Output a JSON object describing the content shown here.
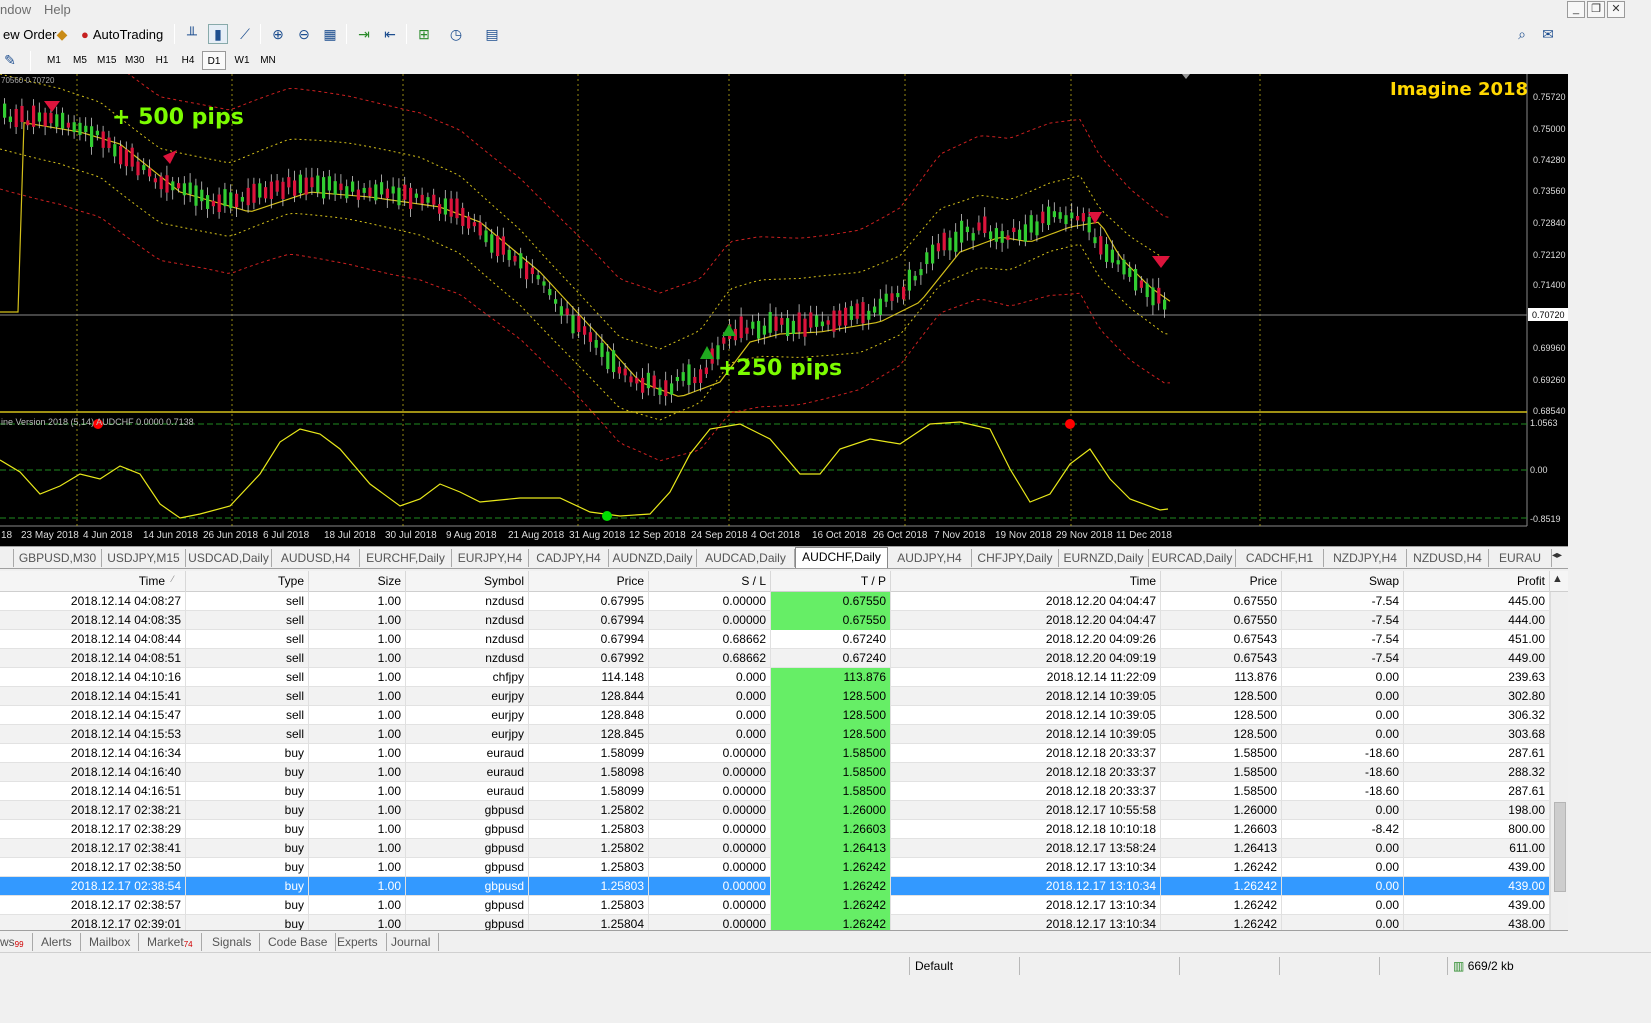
{
  "menu": {
    "window_label": "ndow",
    "help_label": "Help"
  },
  "toolbar": {
    "new_order_label": "ew Order",
    "autotrading_label": "AutoTrading",
    "timeframes": [
      "M1",
      "M5",
      "M15",
      "M30",
      "H1",
      "H4",
      "D1",
      "W1",
      "MN"
    ],
    "active_timeframe": "D1"
  },
  "chart": {
    "header_text": "70560 0.70720",
    "watermark": "Imagine 2018",
    "annotation_top": "+ 500 pips",
    "annotation_bottom": "+250 pips",
    "indicator_label": "ine Version 2018 (5,14) AUDCHF 0.0000 0.7138",
    "price_labels": [
      "0.75720",
      "0.75000",
      "0.74280",
      "0.73560",
      "0.72840",
      "0.72120",
      "0.71400",
      "0.70720",
      "0.69960",
      "0.69260",
      "0.68540"
    ],
    "current_price": "0.70720",
    "indicator_labels": [
      "1.0563",
      "0.00",
      "-0.8519"
    ],
    "date_labels": [
      "18",
      "23 May 2018",
      "4 Jun 2018",
      "14 Jun 2018",
      "26 Jun 2018",
      "6 Jul 2018",
      "18 Jul 2018",
      "30 Jul 2018",
      "9 Aug 2018",
      "21 Aug 2018",
      "31 Aug 2018",
      "12 Sep 2018",
      "24 Sep 2018",
      "4 Oct 2018",
      "16 Oct 2018",
      "26 Oct 2018",
      "7 Nov 2018",
      "19 Nov 2018",
      "29 Nov 2018",
      "11 Dec 2018"
    ],
    "colors": {
      "bull": "#32cd32",
      "bear": "#dc143c",
      "band_mid": "#d4c01a",
      "band_outer": "#cc2020",
      "annotation": "#7cfc00",
      "watermark": "#ffd700"
    }
  },
  "symbol_tabs": [
    "GBPUSD,M30",
    "USDJPY,M15",
    "USDCAD,Daily",
    "AUDUSD,H4",
    "EURCHF,Daily",
    "EURJPY,H4",
    "CADJPY,H4",
    "AUDNZD,Daily",
    "AUDCAD,Daily",
    "AUDCHF,Daily",
    "AUDJPY,H4",
    "CHFJPY,Daily",
    "EURNZD,Daily",
    "EURCAD,Daily",
    "CADCHF,H1",
    "NZDJPY,H4",
    "NZDUSD,H4",
    "EURAU"
  ],
  "active_symbol_tab": "AUDCHF,Daily",
  "table": {
    "headers": [
      "Time",
      "Type",
      "Size",
      "Symbol",
      "Price",
      "S / L",
      "T / P",
      "Time",
      "Price",
      "Swap",
      "Profit"
    ],
    "rows": [
      [
        "2018.12.14 04:08:27",
        "sell",
        "1.00",
        "nzdusd",
        "0.67995",
        "0.00000",
        "0.67550",
        "2018.12.20 04:04:47",
        "0.67550",
        "-7.54",
        "445.00"
      ],
      [
        "2018.12.14 04:08:35",
        "sell",
        "1.00",
        "nzdusd",
        "0.67994",
        "0.00000",
        "0.67550",
        "2018.12.20 04:04:47",
        "0.67550",
        "-7.54",
        "444.00"
      ],
      [
        "2018.12.14 04:08:44",
        "sell",
        "1.00",
        "nzdusd",
        "0.67994",
        "0.68662",
        "0.67240",
        "2018.12.20 04:09:26",
        "0.67543",
        "-7.54",
        "451.00"
      ],
      [
        "2018.12.14 04:08:51",
        "sell",
        "1.00",
        "nzdusd",
        "0.67992",
        "0.68662",
        "0.67240",
        "2018.12.20 04:09:19",
        "0.67543",
        "-7.54",
        "449.00"
      ],
      [
        "2018.12.14 04:10:16",
        "sell",
        "1.00",
        "chfjpy",
        "114.148",
        "0.000",
        "113.876",
        "2018.12.14 11:22:09",
        "113.876",
        "0.00",
        "239.63"
      ],
      [
        "2018.12.14 04:15:41",
        "sell",
        "1.00",
        "eurjpy",
        "128.844",
        "0.000",
        "128.500",
        "2018.12.14 10:39:05",
        "128.500",
        "0.00",
        "302.80"
      ],
      [
        "2018.12.14 04:15:47",
        "sell",
        "1.00",
        "eurjpy",
        "128.848",
        "0.000",
        "128.500",
        "2018.12.14 10:39:05",
        "128.500",
        "0.00",
        "306.32"
      ],
      [
        "2018.12.14 04:15:53",
        "sell",
        "1.00",
        "eurjpy",
        "128.845",
        "0.000",
        "128.500",
        "2018.12.14 10:39:05",
        "128.500",
        "0.00",
        "303.68"
      ],
      [
        "2018.12.14 04:16:34",
        "buy",
        "1.00",
        "euraud",
        "1.58099",
        "0.00000",
        "1.58500",
        "2018.12.18 20:33:37",
        "1.58500",
        "-18.60",
        "287.61"
      ],
      [
        "2018.12.14 04:16:40",
        "buy",
        "1.00",
        "euraud",
        "1.58098",
        "0.00000",
        "1.58500",
        "2018.12.18 20:33:37",
        "1.58500",
        "-18.60",
        "288.32"
      ],
      [
        "2018.12.14 04:16:51",
        "buy",
        "1.00",
        "euraud",
        "1.58099",
        "0.00000",
        "1.58500",
        "2018.12.18 20:33:37",
        "1.58500",
        "-18.60",
        "287.61"
      ],
      [
        "2018.12.17 02:38:21",
        "buy",
        "1.00",
        "gbpusd",
        "1.25802",
        "0.00000",
        "1.26000",
        "2018.12.17 10:55:58",
        "1.26000",
        "0.00",
        "198.00"
      ],
      [
        "2018.12.17 02:38:29",
        "buy",
        "1.00",
        "gbpusd",
        "1.25803",
        "0.00000",
        "1.26603",
        "2018.12.18 10:10:18",
        "1.26603",
        "-8.42",
        "800.00"
      ],
      [
        "2018.12.17 02:38:41",
        "buy",
        "1.00",
        "gbpusd",
        "1.25802",
        "0.00000",
        "1.26413",
        "2018.12.17 13:58:24",
        "1.26413",
        "0.00",
        "611.00"
      ],
      [
        "2018.12.17 02:38:50",
        "buy",
        "1.00",
        "gbpusd",
        "1.25803",
        "0.00000",
        "1.26242",
        "2018.12.17 13:10:34",
        "1.26242",
        "0.00",
        "439.00"
      ],
      [
        "2018.12.17 02:38:54",
        "buy",
        "1.00",
        "gbpusd",
        "1.25803",
        "0.00000",
        "1.26242",
        "2018.12.17 13:10:34",
        "1.26242",
        "0.00",
        "439.00"
      ],
      [
        "2018.12.17 02:38:57",
        "buy",
        "1.00",
        "gbpusd",
        "1.25803",
        "0.00000",
        "1.26242",
        "2018.12.17 13:10:34",
        "1.26242",
        "0.00",
        "439.00"
      ],
      [
        "2018.12.17 02:39:01",
        "buy",
        "1.00",
        "gbpusd",
        "1.25804",
        "0.00000",
        "1.26242",
        "2018.12.17 13:10:34",
        "1.26242",
        "0.00",
        "438.00"
      ]
    ],
    "tp_highlight_rows": [
      0,
      1,
      4,
      5,
      6,
      7,
      8,
      9,
      10,
      11,
      12,
      13,
      14,
      15,
      16,
      17
    ],
    "selected_row": 15
  },
  "terminal_tabs": [
    {
      "label": "ws",
      "badge": "99"
    },
    {
      "label": "Alerts",
      "badge": ""
    },
    {
      "label": "Mailbox",
      "badge": ""
    },
    {
      "label": "Market",
      "badge": "74"
    },
    {
      "label": "Signals",
      "badge": ""
    },
    {
      "label": "Code Base",
      "badge": ""
    },
    {
      "label": "Experts",
      "badge": ""
    },
    {
      "label": "Journal",
      "badge": ""
    }
  ],
  "status": {
    "profile": "Default",
    "traffic": "669/2 kb"
  }
}
